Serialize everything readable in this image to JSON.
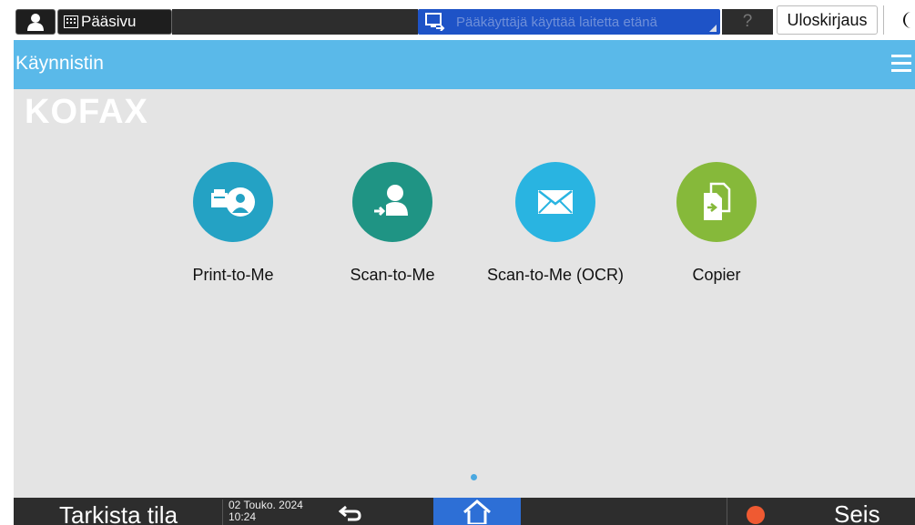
{
  "topbar": {
    "home_label": "Pääsivu",
    "remote_notice": "Pääkäyttäjä käyttää laitetta etänä",
    "help_label": "?",
    "logout_label": "Uloskirjaus"
  },
  "titlebar": {
    "title": "Käynnistin"
  },
  "main": {
    "logo": "KOFAX",
    "apps": [
      {
        "label": "Print-to-Me",
        "color": "#24a2c4",
        "icon": "print-to-me-icon"
      },
      {
        "label": "Scan-to-Me",
        "color": "#1f9484",
        "icon": "scan-to-me-icon"
      },
      {
        "label": "Scan-to-Me (OCR)",
        "color": "#29b4e1",
        "icon": "envelope-icon"
      },
      {
        "label": "Copier",
        "color": "#86b93a",
        "icon": "copier-icon"
      }
    ]
  },
  "bottombar": {
    "status_label": "Tarkista tila",
    "date": "02 Touko. 2024",
    "time": "10:24",
    "stop_label": "Seis"
  },
  "colors": {
    "title_bar": "#5ab9e9",
    "remote_banner": "#1e53c7",
    "home_nav": "#2d6fd6",
    "stop": "#ef5a32"
  }
}
